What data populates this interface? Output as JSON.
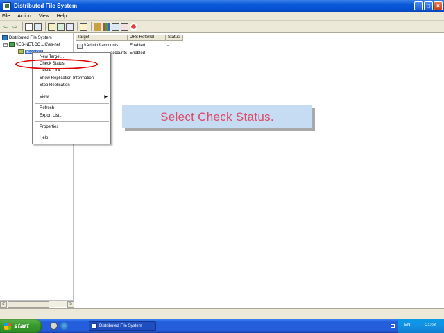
{
  "window": {
    "title": "Distributed File System",
    "minimize_glyph": "_",
    "maximize_glyph": "□",
    "close_glyph": "×"
  },
  "menubar": {
    "items": [
      "File",
      "Action",
      "View",
      "Help"
    ]
  },
  "toolbar": {
    "back_glyph": "⇦",
    "forward_glyph": "⇨"
  },
  "tree": {
    "root_label": "Distributed File System",
    "dfs_root_label": "\\\\ES-NET.CO.UK\\es-net",
    "expander_glyph": "−",
    "selected_link_label": "accounts"
  },
  "columns": {
    "target": "Target",
    "referral": "DFS Referral",
    "status": "Status"
  },
  "rows": [
    {
      "target": "\\\\Admin3\\accounts",
      "referral": "Enabled",
      "status": "-"
    },
    {
      "target": "accounts",
      "referral": "Enabled",
      "status": "-"
    }
  ],
  "context_menu": {
    "new_target": "New Target...",
    "check_status": "Check Status",
    "delete_link": "Delete Link",
    "show_replication": "Show Replication Information",
    "stop_replication": "Stop Replication",
    "view": "View",
    "view_arrow": "▶",
    "refresh": "Refresh",
    "export_list": "Export List...",
    "properties": "Properties",
    "help": "Help"
  },
  "callout": {
    "text": "Select Check Status."
  },
  "scroll": {
    "left_glyph": "<",
    "right_glyph": ">"
  },
  "taskbar": {
    "start_label": "start",
    "task_label": "Distributed File System",
    "language": "EN",
    "clock": "21:03"
  },
  "colors": {
    "title_bar": "#0a58d8",
    "callout_text": "#e04868",
    "callout_bg": "#c6dcf2",
    "highlight_ring": "#e00000"
  }
}
